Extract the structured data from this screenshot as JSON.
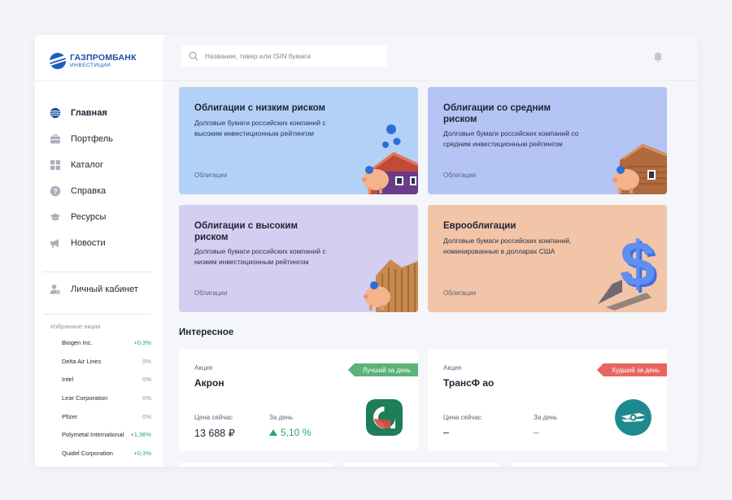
{
  "brand": {
    "name": "ГАЗПРОМБАНК",
    "sub": "ИНВЕСТИЦИИ"
  },
  "search": {
    "placeholder": "Название, тикер или ISIN бумаги"
  },
  "nav": [
    {
      "label": "Главная",
      "icon": "globe-icon"
    },
    {
      "label": "Портфель",
      "icon": "briefcase-icon"
    },
    {
      "label": "Каталог",
      "icon": "grid-icon"
    },
    {
      "label": "Справка",
      "icon": "help-icon"
    },
    {
      "label": "Ресурсы",
      "icon": "graduation-cap-icon"
    },
    {
      "label": "Новости",
      "icon": "megaphone-icon"
    }
  ],
  "cabinet": {
    "label": "Личный кабинет",
    "icon": "user-settings-icon"
  },
  "favorites": {
    "title": "Избранные акции",
    "items": [
      {
        "name": "Biogen Inc.",
        "value": "+0,3%"
      },
      {
        "name": "Delta Air Lines",
        "value": "0%"
      },
      {
        "name": "Intel",
        "value": "0%"
      },
      {
        "name": "Lear Corporation",
        "value": "0%"
      },
      {
        "name": "Pfizer",
        "value": "0%"
      },
      {
        "name": "Polymetal International",
        "value": "+1,36%"
      },
      {
        "name": "Quidel Corporation",
        "value": "+0,3%"
      }
    ]
  },
  "cards": [
    {
      "title": "Облигации с низким риском",
      "desc": "Долговые бумаги российских компаний с высоким инвестиционным рейтингом",
      "tag": "Облигации",
      "color": "#b3d1f7"
    },
    {
      "title": "Облигации со средним риском",
      "desc": "Долговые бумаги российских компаний со средним инвестиционным рейтингом",
      "tag": "Облигации",
      "color": "#b3c4f5"
    },
    {
      "title": "Облигации с высоким риском",
      "desc": "Долговые бумаги российских компаний с низким инвестиционным рейтингом",
      "tag": "Облигации",
      "color": "#d6cdf2"
    },
    {
      "title": "Еврооблигации",
      "desc": "Долговые бумаги российских компаний, номинированные в долларах США",
      "tag": "Облигации",
      "color": "#f2c4a8"
    }
  ],
  "section": {
    "title": "Интересное"
  },
  "stocks": [
    {
      "type": "Акция",
      "name": "Акрон",
      "badge": "Лучший за день",
      "badge_color": "#5cb279",
      "price_label": "Цена сейчас",
      "price": "13 688 ₽",
      "change_label": "За день",
      "change": "5,10 %"
    },
    {
      "type": "Акция",
      "name": "ТрансФ ао",
      "badge": "Худший за день",
      "badge_color": "#e8665f",
      "price_label": "Цена сейчас",
      "price": "–",
      "change_label": "За день",
      "change": "–"
    }
  ]
}
